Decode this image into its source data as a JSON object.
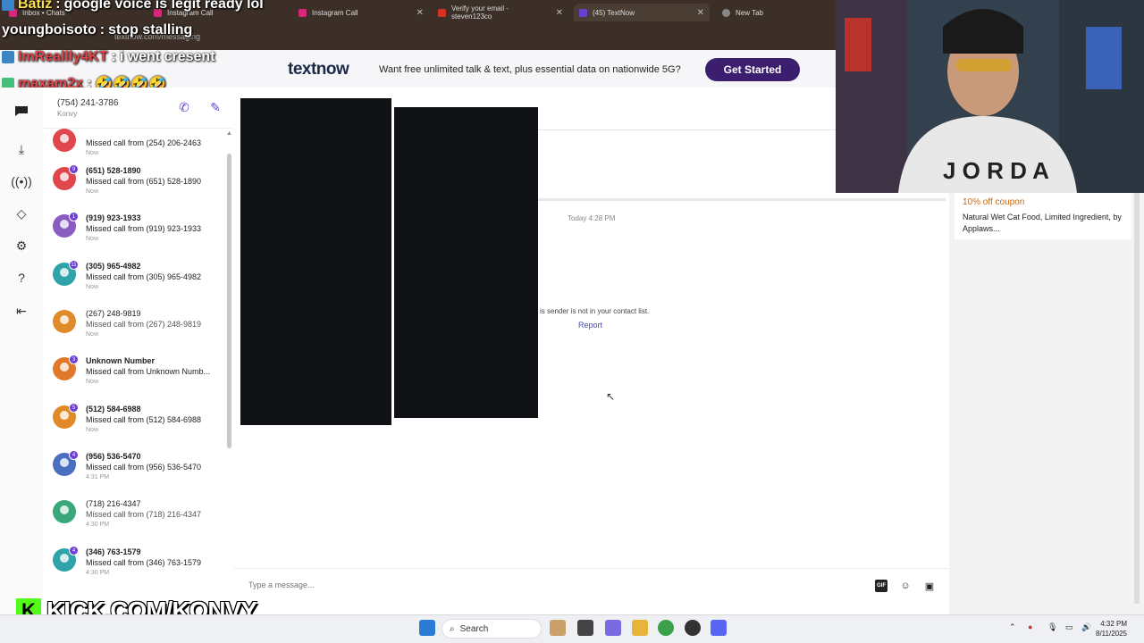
{
  "browser": {
    "tabs": [
      {
        "label": "Inbox • Chats"
      },
      {
        "label": "Instagram Call"
      },
      {
        "label": "Instagram Call"
      },
      {
        "label": "Verify your email - steven123co"
      },
      {
        "label": "(45) TextNow"
      },
      {
        "label": "New Tab"
      }
    ],
    "url": "textnow.com/messaging"
  },
  "chat_overlay": [
    {
      "user": "Batiz",
      "message": "google voice is legit ready lol"
    },
    {
      "user": "youngboisoto",
      "message": "stop stalling"
    },
    {
      "user": "ImReallly4KT",
      "message": "i went cresent"
    },
    {
      "user": "maxam2x",
      "message": "🤣🤣🤣🤣"
    }
  ],
  "banner": {
    "logo": "textnow",
    "promo": "Want free unlimited talk & text, plus essential data on nationwide 5G?",
    "cta": "Get Started"
  },
  "account": {
    "phone": "(754) 241-3786",
    "name": "Konvy"
  },
  "conversations": [
    {
      "name": "",
      "preview": "Missed call from (254) 206-2463",
      "time": "Now",
      "bold": true,
      "color": "#e0474c",
      "count": ""
    },
    {
      "name": "(651) 528-1890",
      "preview": "Missed call from (651) 528-1890",
      "time": "Now",
      "bold": true,
      "color": "#e0474c",
      "count": "9"
    },
    {
      "name": "(919) 923-1933",
      "preview": "Missed call from (919) 923-1933",
      "time": "Now",
      "bold": true,
      "color": "#8a5cc0",
      "count": "1"
    },
    {
      "name": "(305) 965-4982",
      "preview": "Missed call from (305) 965-4982",
      "time": "Now",
      "bold": true,
      "color": "#2fa3a8",
      "count": "11"
    },
    {
      "name": "(267) 248-9819",
      "preview": "Missed call from (267) 248-9819",
      "time": "Now",
      "bold": false,
      "color": "#e08a2a",
      "count": ""
    },
    {
      "name": "Unknown Number",
      "preview": "Missed call from Unknown Numb...",
      "time": "Now",
      "bold": true,
      "color": "#e07a2a",
      "count": "3"
    },
    {
      "name": "(512) 584-6988",
      "preview": "Missed call from (512) 584-6988",
      "time": "Now",
      "bold": true,
      "color": "#e08a2a",
      "count": "5"
    },
    {
      "name": "(956) 536-5470",
      "preview": "Missed call from (956) 536-5470",
      "time": "4:31 PM",
      "bold": true,
      "color": "#4a6ec0",
      "count": "4"
    },
    {
      "name": "(718) 216-4347",
      "preview": "Missed call from (718) 216-4347",
      "time": "4:30 PM",
      "bold": false,
      "color": "#3aa87a",
      "count": ""
    },
    {
      "name": "(346) 763-1579",
      "preview": "Missed call from (346) 763-1579",
      "time": "4:30 PM",
      "bold": true,
      "color": "#2fa3a8",
      "count": "4"
    }
  ],
  "thread": {
    "date": "Today 4:28 PM",
    "notice": "is sender is not in your contact list.",
    "report": "Report",
    "input_placeholder": "Type a message..."
  },
  "ad": {
    "coupon": "10% off coupon",
    "text": "Natural Wet Cat Food, Limited Ingredient, by Applaws..."
  },
  "watermark": {
    "text": "KICK.COM/KONVY"
  },
  "taskbar": {
    "search": "Search",
    "time": "4:32 PM",
    "date": "8/11/2025"
  },
  "colors": {
    "brand": "#3b1f6e",
    "accent": "#6b3fd1"
  }
}
